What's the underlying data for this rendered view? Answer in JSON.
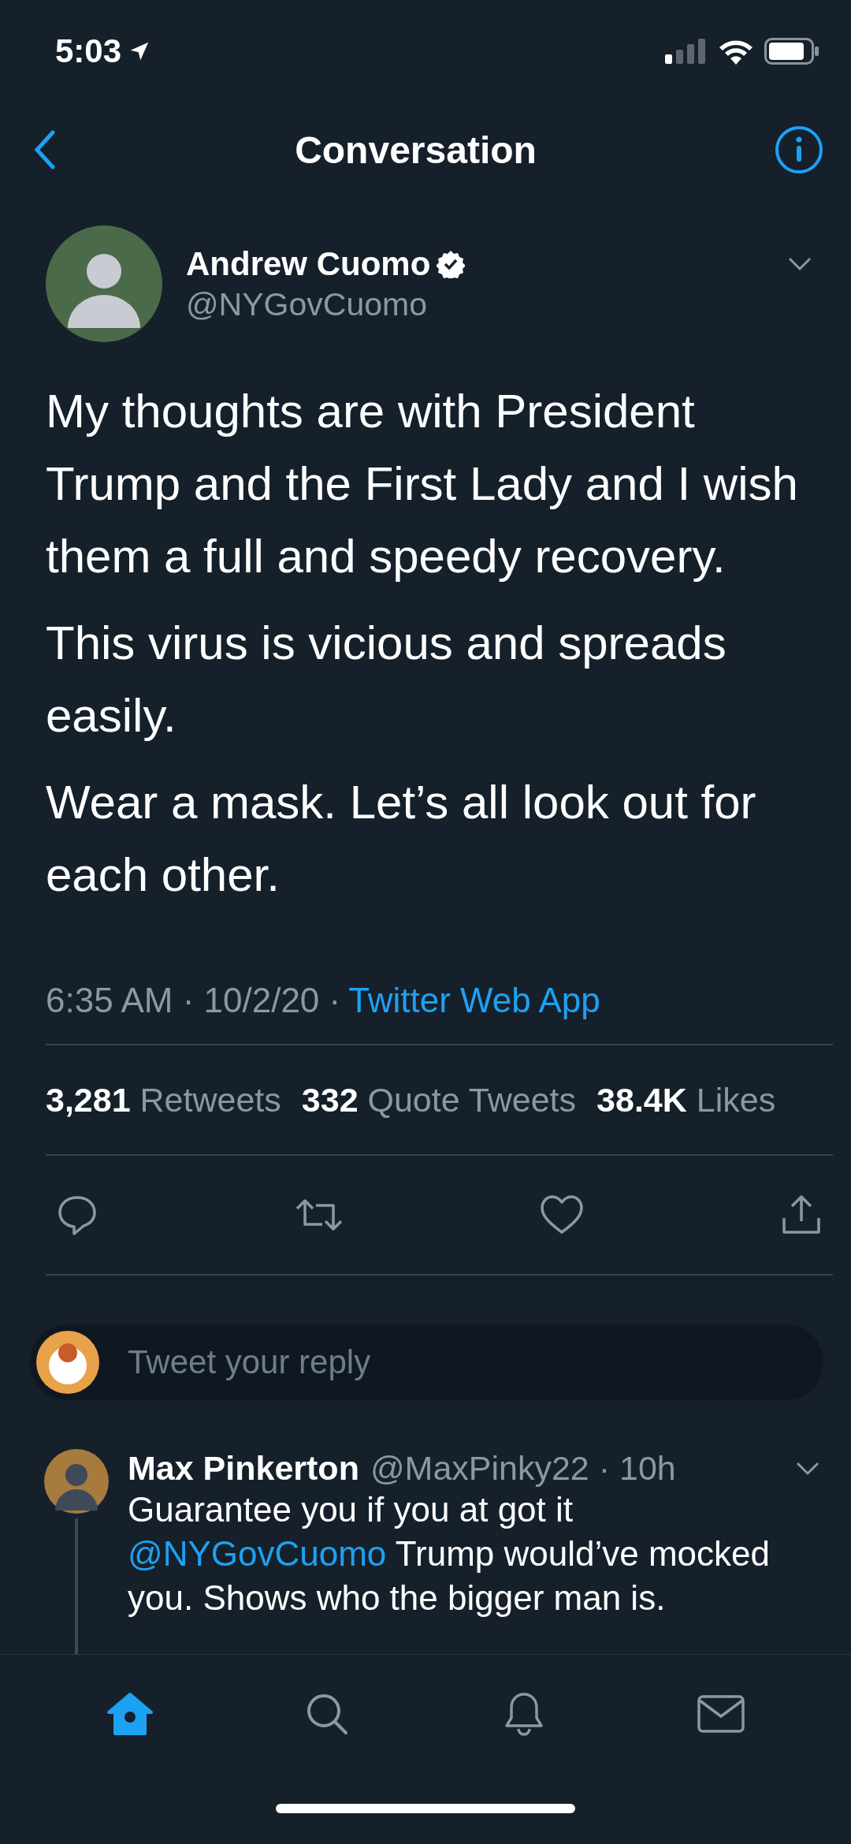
{
  "status_bar": {
    "time": "5:03"
  },
  "nav": {
    "title": "Conversation"
  },
  "tweet": {
    "author": {
      "name": "Andrew Cuomo",
      "verified": true,
      "handle": "@NYGovCuomo"
    },
    "paragraphs": [
      "My thoughts are with President Trump and the First Lady and I wish them a full and speedy recovery.",
      "This virus is vicious and spreads easily.",
      "Wear a mask. Let’s all look out for each other."
    ],
    "timestamp": "6:35 AM · 10/2/20 ·",
    "source": "Twitter Web App",
    "stats": [
      {
        "count": "3,281",
        "label": "Retweets"
      },
      {
        "count": "332",
        "label": "Quote Tweets"
      },
      {
        "count": "38.4K",
        "label": "Likes"
      }
    ],
    "actions": [
      {
        "kind": "reply"
      },
      {
        "kind": "retweet"
      },
      {
        "kind": "like"
      },
      {
        "kind": "share"
      }
    ]
  },
  "reply_box": {
    "placeholder": "Tweet your reply"
  },
  "replies": [
    {
      "name": "Max Pinkerton",
      "meta": "@MaxPinky22 · 10h",
      "thread": true,
      "segments": [
        {
          "kind": "text",
          "text": "Guarantee you if you at got it "
        },
        {
          "kind": "mention",
          "text": "@NYGovCuomo"
        },
        {
          "kind": "text",
          "text": " Trump would’ve mocked you. Shows who the bigger man is."
        }
      ]
    }
  ],
  "tab_bar": [
    {
      "kind": "home",
      "selected": true
    },
    {
      "kind": "search",
      "selected": false
    },
    {
      "kind": "notifications",
      "selected": false
    },
    {
      "kind": "messages",
      "selected": false
    }
  ]
}
